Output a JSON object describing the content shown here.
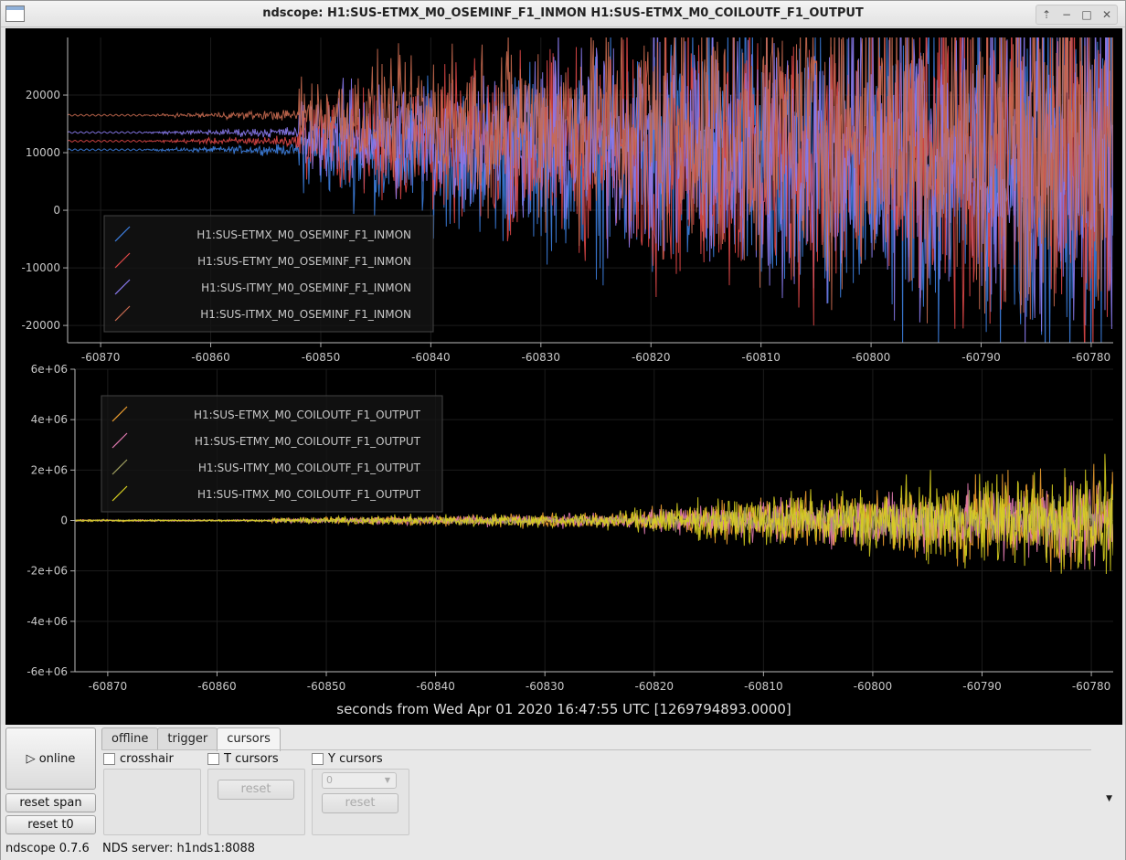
{
  "window": {
    "title": "ndscope: H1:SUS-ETMX_M0_OSEMINF_F1_INMON H1:SUS-ETMX_M0_COILOUTF_F1_OUTPUT"
  },
  "plots": {
    "xlabel": "seconds from Wed Apr 01 2020 16:47:55 UTC [1269794893.0000]",
    "x_ticks": [
      "-60870",
      "-60860",
      "-60850",
      "-60840",
      "-60830",
      "-60820",
      "-60810",
      "-60800",
      "-60790",
      "-60780"
    ],
    "top": {
      "y_ticks": [
        "20000",
        "10000",
        "0",
        "-10000",
        "-20000"
      ],
      "legend": [
        {
          "label": "H1:SUS-ETMX_M0_OSEMINF_F1_INMON",
          "color": "#3d7fe0"
        },
        {
          "label": "H1:SUS-ETMY_M0_OSEMINF_F1_INMON",
          "color": "#e04848"
        },
        {
          "label": "H1:SUS-ITMY_M0_OSEMINF_F1_INMON",
          "color": "#8b7bf0"
        },
        {
          "label": "H1:SUS-ITMX_M0_OSEMINF_F1_INMON",
          "color": "#c86a50"
        }
      ]
    },
    "bottom": {
      "y_ticks": [
        "6e+06",
        "4e+06",
        "2e+06",
        "0",
        "-2e+06",
        "-4e+06",
        "-6e+06"
      ],
      "legend": [
        {
          "label": "H1:SUS-ETMX_M0_COILOUTF_F1_OUTPUT",
          "color": "#f0a030"
        },
        {
          "label": "H1:SUS-ETMY_M0_COILOUTF_F1_OUTPUT",
          "color": "#e07ab0"
        },
        {
          "label": "H1:SUS-ITMY_M0_COILOUTF_F1_OUTPUT",
          "color": "#a0a060"
        },
        {
          "label": "H1:SUS-ITMX_M0_COILOUTF_F1_OUTPUT",
          "color": "#d8d020"
        }
      ]
    }
  },
  "chart_data": [
    {
      "type": "line",
      "xlim": [
        -60873,
        -60778
      ],
      "ylim": [
        -23000,
        30000
      ],
      "series": [
        {
          "name": "H1:SUS-ETMX_M0_OSEMINF_F1_INMON",
          "x": [
            -60873,
            -60852,
            -60850,
            -60840,
            -60820,
            -60800,
            -60780
          ],
          "y": [
            10500,
            10500,
            8000,
            3000,
            0,
            0,
            0
          ]
        },
        {
          "name": "H1:SUS-ETMY_M0_OSEMINF_F1_INMON",
          "x": [
            -60873,
            -60852,
            -60850,
            -60840,
            -60820,
            -60800,
            -60780
          ],
          "y": [
            12000,
            12000,
            12000,
            10000,
            8000,
            8000,
            8000
          ]
        },
        {
          "name": "H1:SUS-ITMY_M0_OSEMINF_F1_INMON",
          "x": [
            -60873,
            -60852,
            -60850,
            -60840,
            -60820,
            -60800,
            -60780
          ],
          "y": [
            13500,
            13500,
            12000,
            10000,
            8000,
            8000,
            8000
          ]
        },
        {
          "name": "H1:SUS-ITMX_M0_OSEMINF_F1_INMON",
          "x": [
            -60873,
            -60865,
            -60852,
            -60850,
            -60840,
            -60820,
            -60800,
            -60780
          ],
          "y": [
            16500,
            16500,
            16000,
            14000,
            12000,
            10000,
            10000,
            10000
          ]
        }
      ]
    },
    {
      "type": "line",
      "xlim": [
        -60873,
        -60778
      ],
      "ylim": [
        -6000000,
        6000000
      ],
      "series": [
        {
          "name": "H1:SUS-ETMX_M0_COILOUTF_F1_OUTPUT",
          "x": [
            -60873,
            -60850,
            -60820,
            -60800,
            -60780
          ],
          "y": [
            0,
            0,
            0,
            0,
            0
          ]
        },
        {
          "name": "H1:SUS-ETMY_M0_COILOUTF_F1_OUTPUT",
          "x": [
            -60873,
            -60850,
            -60820,
            -60800,
            -60780
          ],
          "y": [
            0,
            0,
            0,
            0,
            0
          ]
        },
        {
          "name": "H1:SUS-ITMY_M0_COILOUTF_F1_OUTPUT",
          "x": [
            -60873,
            -60850,
            -60820,
            -60800,
            -60780
          ],
          "y": [
            0,
            0,
            0,
            0,
            0
          ]
        },
        {
          "name": "H1:SUS-ITMX_M0_COILOUTF_F1_OUTPUT",
          "x": [
            -60873,
            -60850,
            -60820,
            -60800,
            -60780
          ],
          "y": [
            0,
            0,
            0,
            0,
            0
          ]
        }
      ]
    }
  ],
  "controls": {
    "online_label": "▷ online",
    "reset_span_label": "reset span",
    "reset_t0_label": "reset t0",
    "tabs": [
      "offline",
      "trigger",
      "cursors"
    ],
    "crosshair_label": "crosshair",
    "t_cursors_label": "T cursors",
    "y_cursors_label": "Y cursors",
    "reset_label": "reset",
    "y_cursor_select": "0"
  },
  "status": {
    "version": "ndscope 0.7.6",
    "server": "NDS server: h1nds1:8088"
  }
}
